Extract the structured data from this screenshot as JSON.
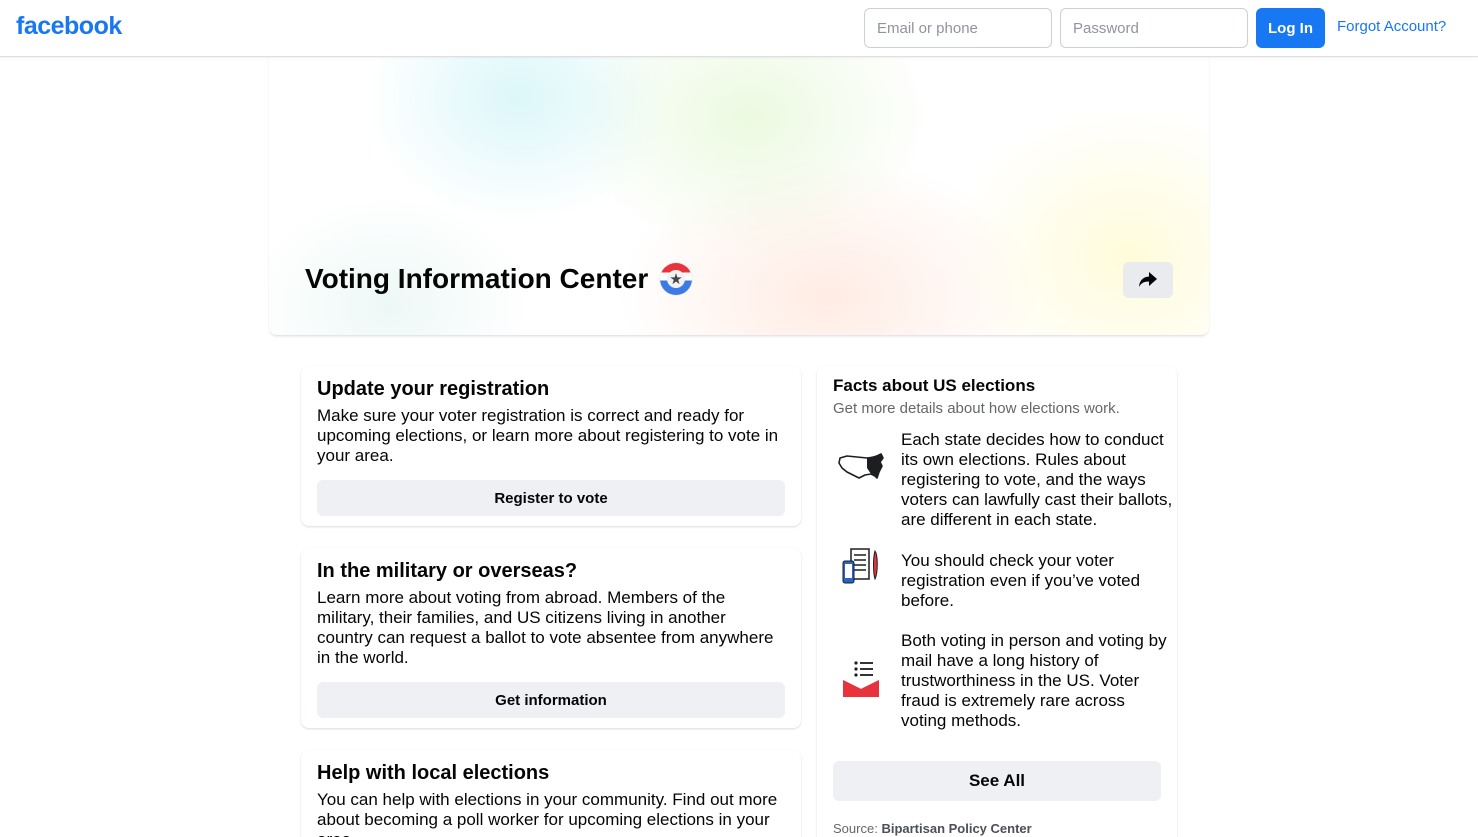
{
  "header": {
    "logo": "facebook",
    "email_placeholder": "Email or phone",
    "password_placeholder": "Password",
    "login_label": "Log In",
    "forgot_label": "Forgot Account?"
  },
  "hero": {
    "title": "Voting Information Center",
    "badge_icon": "star-badge-icon",
    "share_icon": "share-arrow-icon"
  },
  "cards": [
    {
      "title": "Update your registration",
      "body": "Make sure your voter registration is correct and ready for upcoming elections, or learn more about registering to vote in your area.",
      "button": "Register to vote"
    },
    {
      "title": "In the military or overseas?",
      "body": "Learn more about voting from abroad. Members of the military, their families, and US citizens living in another country can request a ballot to vote absentee from anywhere in the world.",
      "button": "Get information"
    },
    {
      "title": "Help with local elections",
      "body": "You can help with elections in your community. Find out more about becoming a poll worker for upcoming elections in your area."
    }
  ],
  "facts": {
    "title": "Facts about US elections",
    "subtitle": "Get more details about how elections work.",
    "items": [
      {
        "icon": "us-map-icon",
        "text": "Each state decides how to conduct its own elections. Rules about registering to vote, and the ways voters can lawfully cast their ballots, are different in each state."
      },
      {
        "icon": "phone-checklist-icon",
        "text": "You should check your voter registration even if you’ve voted before."
      },
      {
        "icon": "mail-ballot-icon",
        "text": "Both voting in person and voting by mail have a long history of trustworthiness in the US. Voter fraud is extremely rare across voting methods."
      }
    ],
    "see_all": "See All",
    "source_prefix": "Source:",
    "source_name": "Bipartisan Policy Center"
  },
  "colors": {
    "brand": "#1877f2",
    "button_bg": "#eff0f4",
    "secondary_text": "#65676b"
  }
}
